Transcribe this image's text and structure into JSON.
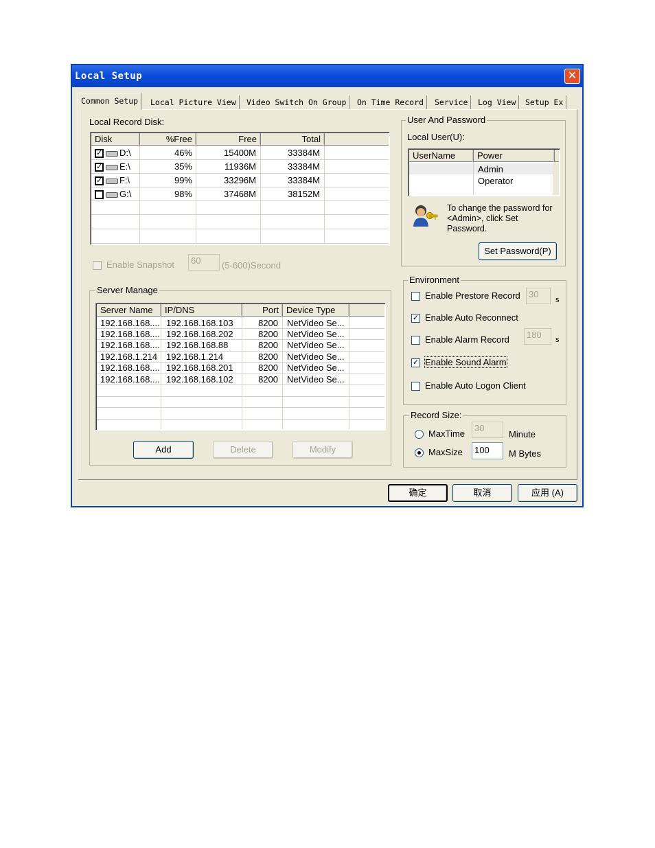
{
  "window": {
    "title": "Local Setup",
    "close_label": "✕"
  },
  "tabs": [
    {
      "label": "Common Setup",
      "active": true
    },
    {
      "label": "Local Picture View"
    },
    {
      "label": "Video Switch On Group"
    },
    {
      "label": "On Time Record"
    },
    {
      "label": "Service"
    },
    {
      "label": "Log View"
    },
    {
      "label": "Setup Ex"
    }
  ],
  "disk": {
    "label": "Local Record Disk:",
    "columns": [
      "Disk",
      "%Free",
      "Free",
      "Total"
    ],
    "rows": [
      {
        "checked": true,
        "disk": "D:\\",
        "pct": "46%",
        "free": "15400M",
        "total": "33384M"
      },
      {
        "checked": true,
        "disk": "E:\\",
        "pct": "35%",
        "free": "11936M",
        "total": "33384M"
      },
      {
        "checked": true,
        "disk": "F:\\",
        "pct": "99%",
        "free": "33296M",
        "total": "33384M"
      },
      {
        "checked": false,
        "disk": "G:\\",
        "pct": "98%",
        "free": "37468M",
        "total": "38152M"
      }
    ]
  },
  "snapshot": {
    "label": "Enable Snapshot",
    "value": "60",
    "unit": "(5-600)Second"
  },
  "server": {
    "label": "Server Manage",
    "columns": [
      "Server Name",
      "IP/DNS",
      "Port",
      "Device Type"
    ],
    "rows": [
      {
        "name": "192.168.168....",
        "ip": "192.168.168.103",
        "port": "8200",
        "type": "NetVideo Se..."
      },
      {
        "name": "192.168.168....",
        "ip": "192.168.168.202",
        "port": "8200",
        "type": "NetVideo Se..."
      },
      {
        "name": "192.168.168....",
        "ip": "192.168.168.88",
        "port": "8200",
        "type": "NetVideo Se..."
      },
      {
        "name": "192.168.1.214",
        "ip": "192.168.1.214",
        "port": "8200",
        "type": "NetVideo Se..."
      },
      {
        "name": "192.168.168....",
        "ip": "192.168.168.201",
        "port": "8200",
        "type": "NetVideo Se..."
      },
      {
        "name": "192.168.168....",
        "ip": "192.168.168.102",
        "port": "8200",
        "type": "NetVideo Se..."
      }
    ],
    "add": "Add",
    "delete": "Delete",
    "modify": "Modify"
  },
  "user": {
    "group_label": "User And Password",
    "local_user_label": "Local User(U):",
    "columns": [
      "UserName",
      "Power"
    ],
    "rows": [
      {
        "name": "",
        "power": "Admin"
      },
      {
        "name": "",
        "power": "Operator"
      }
    ],
    "hint": [
      "To change the password for",
      "<Admin>, click Set",
      "Password."
    ],
    "set_password": "Set Password(P)"
  },
  "environment": {
    "label": "Environment",
    "prestore": {
      "label": "Enable Prestore Record",
      "checked": false,
      "value": "30",
      "unit": "s"
    },
    "reconnect": {
      "label": "Enable Auto Reconnect",
      "checked": true
    },
    "alarm_record": {
      "label": "Enable Alarm Record",
      "checked": false,
      "value": "180",
      "unit": "s"
    },
    "sound_alarm": {
      "label": "Enable Sound Alarm",
      "checked": true
    },
    "auto_logon": {
      "label": "Enable Auto Logon Client",
      "checked": false
    }
  },
  "record_size": {
    "label": "Record Size:",
    "maxtime": {
      "label": "MaxTime",
      "value": "30",
      "unit": "Minute",
      "selected": false
    },
    "maxsize": {
      "label": "MaxSize",
      "value": "100",
      "unit": "M Bytes",
      "selected": true
    }
  },
  "footer": {
    "ok": "确定",
    "cancel": "取消",
    "apply": "应用 (A)"
  }
}
